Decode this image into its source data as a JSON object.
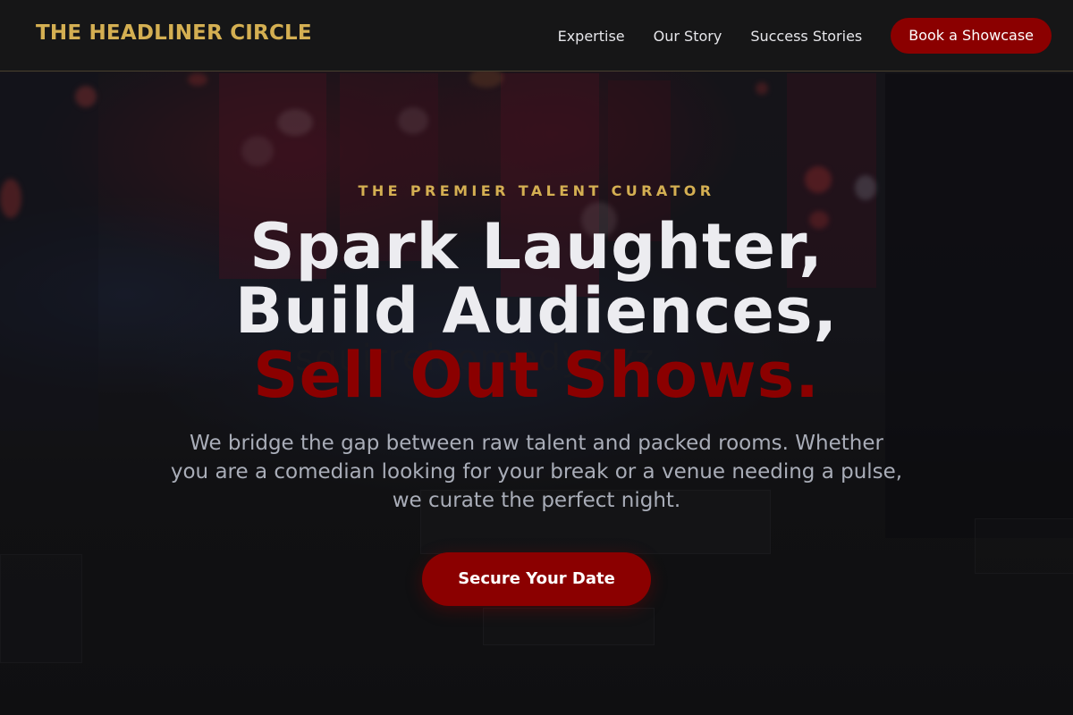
{
  "header": {
    "logo": "THE HEADLINER CIRCLE",
    "nav": [
      {
        "label": "Expertise"
      },
      {
        "label": "Our Story"
      },
      {
        "label": "Success Stories"
      }
    ],
    "cta_label": "Book a Showcase"
  },
  "hero": {
    "eyebrow": "THE PREMIER TALENT CURATOR",
    "headline_line1": "Spark Laughter,",
    "headline_line2": "Build Audiences,",
    "headline_line3": "Sell Out Shows.",
    "subtext": "We bridge the gap between raw talent and packed rooms. Whether you are a comedian looking for your break or a venue needing a pulse, we curate the perfect night.",
    "cta_label": "Secure Your Date",
    "background_watermark": "squirrelcomedy.xyz"
  },
  "colors": {
    "accent_gold": "#d4af52",
    "accent_red": "#8b0000",
    "background": "#121213",
    "text_primary": "#ececf0",
    "text_muted": "#a9adb8"
  }
}
